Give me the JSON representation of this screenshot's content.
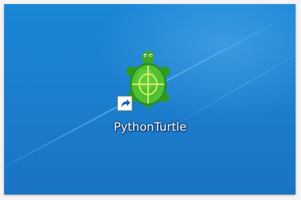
{
  "desktop": {
    "background_color": "#1a80d0",
    "icons": [
      {
        "label": "PythonTurtle",
        "icon": "turtle-icon",
        "overlay": "shortcut-arrow-icon",
        "turtle_color": "#3fae2a"
      }
    ]
  }
}
